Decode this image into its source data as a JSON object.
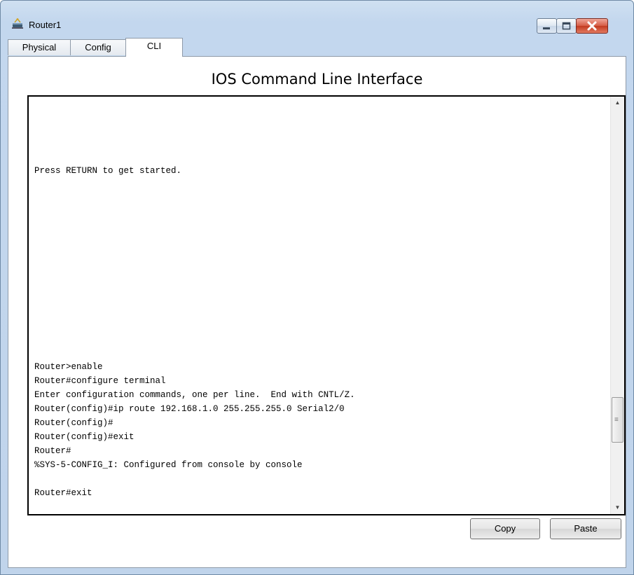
{
  "window": {
    "title": "Router1",
    "icon": "router-icon",
    "controls": [
      "minimize-icon",
      "maximize-icon",
      "close-icon"
    ]
  },
  "tabs": [
    {
      "label": "Physical",
      "active": false
    },
    {
      "label": "Config",
      "active": false
    },
    {
      "label": "CLI",
      "active": true
    }
  ],
  "cli": {
    "heading": "IOS Command Line Interface",
    "output": "Press RETURN to get started.\n\n\n\n\n\n\n\n\n\n\n\n\n\nRouter>enable\nRouter#configure terminal\nEnter configuration commands, one per line.  End with CNTL/Z.\nRouter(config)#ip route 192.168.1.0 255.255.255.0 Serial2/0\nRouter(config)#\nRouter(config)#exit\nRouter#\n%SYS-5-CONFIG_I: Configured from console by console\n\nRouter#exit"
  },
  "buttons": {
    "copy": "Copy",
    "paste": "Paste"
  }
}
